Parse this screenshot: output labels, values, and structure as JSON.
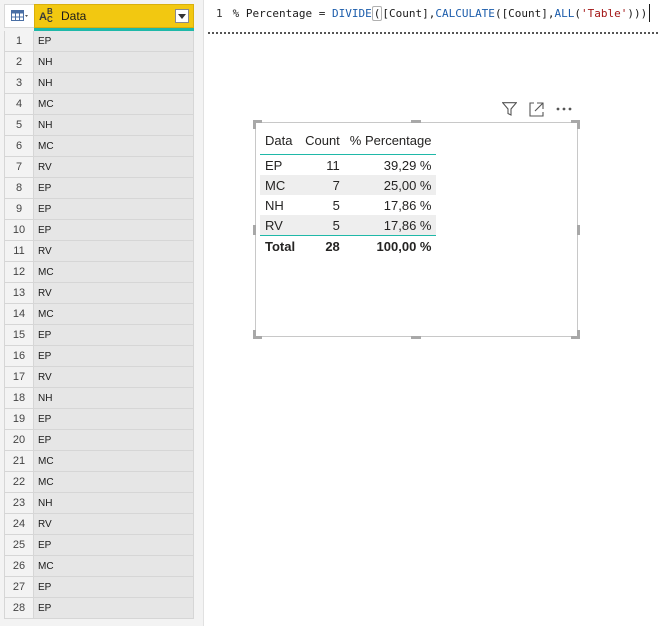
{
  "grid": {
    "column_title": "Data",
    "type_icon": "abc-text-type-icon",
    "rows": [
      {
        "n": "1",
        "v": "EP"
      },
      {
        "n": "2",
        "v": "NH"
      },
      {
        "n": "3",
        "v": "NH"
      },
      {
        "n": "4",
        "v": "MC"
      },
      {
        "n": "5",
        "v": "NH"
      },
      {
        "n": "6",
        "v": "MC"
      },
      {
        "n": "7",
        "v": "RV"
      },
      {
        "n": "8",
        "v": "EP"
      },
      {
        "n": "9",
        "v": "EP"
      },
      {
        "n": "10",
        "v": "EP"
      },
      {
        "n": "11",
        "v": "RV"
      },
      {
        "n": "12",
        "v": "MC"
      },
      {
        "n": "13",
        "v": "RV"
      },
      {
        "n": "14",
        "v": "MC"
      },
      {
        "n": "15",
        "v": "EP"
      },
      {
        "n": "16",
        "v": "EP"
      },
      {
        "n": "17",
        "v": "RV"
      },
      {
        "n": "18",
        "v": "NH"
      },
      {
        "n": "19",
        "v": "EP"
      },
      {
        "n": "20",
        "v": "EP"
      },
      {
        "n": "21",
        "v": "MC"
      },
      {
        "n": "22",
        "v": "MC"
      },
      {
        "n": "23",
        "v": "NH"
      },
      {
        "n": "24",
        "v": "RV"
      },
      {
        "n": "25",
        "v": "EP"
      },
      {
        "n": "26",
        "v": "MC"
      },
      {
        "n": "27",
        "v": "EP"
      },
      {
        "n": "28",
        "v": "EP"
      }
    ]
  },
  "formula": {
    "line_number": "1",
    "measure": "% Percentage = ",
    "divide": "DIVIDE",
    "open1": "(",
    "count1": "[Count]",
    "comma1": ",",
    "calculate": "CALCULATE",
    "open2": "(",
    "count2": "[Count]",
    "comma2": ",",
    "all": "ALL",
    "open3": "(",
    "table": "'Table'",
    "close": ")))"
  },
  "visual_tools": {
    "filter": "filter-icon",
    "focus": "focus-mode-icon",
    "more": "more-options-icon"
  },
  "table": {
    "headers": {
      "data": "Data",
      "count": "Count",
      "percentage": "% Percentage"
    },
    "rows": [
      {
        "data": "EP",
        "count": "11",
        "pct": "39,29 %"
      },
      {
        "data": "MC",
        "count": "7",
        "pct": "25,00 %"
      },
      {
        "data": "NH",
        "count": "5",
        "pct": "17,86 %"
      },
      {
        "data": "RV",
        "count": "5",
        "pct": "17,86 %"
      }
    ],
    "total": {
      "label": "Total",
      "count": "28",
      "pct": "100,00 %"
    }
  },
  "colors": {
    "header_yellow": "#f2c811",
    "accent_teal": "#1fb8a8",
    "keyword_blue": "#1b5cab",
    "string_red": "#a31515"
  }
}
